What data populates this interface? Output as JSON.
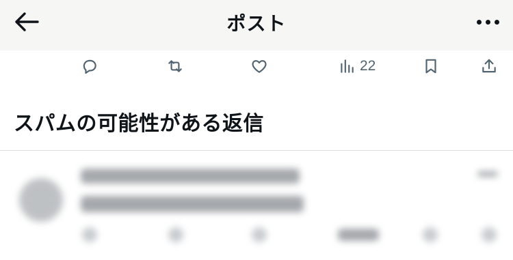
{
  "header": {
    "back_icon": "arrow-left-icon",
    "title": "ポスト",
    "more_icon": "more-horizontal-icon"
  },
  "actions": {
    "reply_icon": "reply-icon",
    "repost_icon": "repost-icon",
    "like_icon": "heart-icon",
    "views_icon": "views-chart-icon",
    "views_count": "22",
    "bookmark_icon": "bookmark-icon",
    "share_icon": "share-icon",
    "icon_color": "#536471"
  },
  "replies_section": {
    "title": "スパムの可能性がある返信"
  },
  "colors": {
    "header_bg": "#f6f6f5",
    "text_primary": "#0f1419",
    "divider": "#dcdfe2"
  }
}
